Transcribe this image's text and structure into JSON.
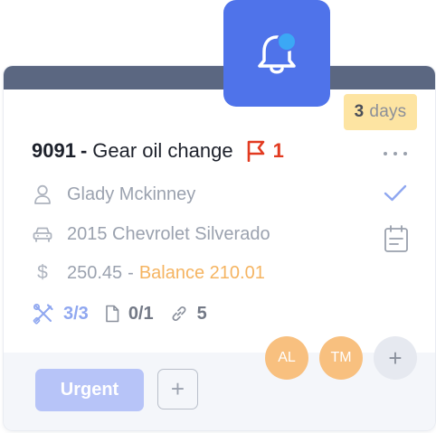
{
  "work_order": {
    "number": "9091",
    "dash": "-",
    "title": "Gear oil change",
    "flag_count": "1",
    "due": {
      "count": "3",
      "unit": "days"
    },
    "assignee": "Glady Mckinney",
    "vehicle": "2015 Chevrolet Silverado",
    "currency_symbol": "$",
    "amount": "250.45",
    "amount_sep": "-",
    "balance": "Balance 210.01",
    "stats": {
      "tasks": "3/3",
      "documents": "0/1",
      "links": "5"
    }
  },
  "avatars": [
    {
      "initials": "AL",
      "color": "#f8c07f"
    },
    {
      "initials": "TM",
      "color": "#f8c07f"
    }
  ],
  "avatar_add_label": "+",
  "tags": {
    "urgent_label": "Urgent",
    "add_label": "+"
  },
  "colors": {
    "accent": "#4f73ea",
    "topbar": "#5b6781",
    "flag": "#e23a20",
    "balance": "#f5b461",
    "days_badge": "#fde4a2",
    "urgent_tag": "#b7c4f8",
    "notification_dot": "#3ba8f5"
  },
  "icons": {
    "notification": "bell-icon",
    "flag": "flag-icon",
    "more": "more-horizontal-icon",
    "assignee": "user-icon",
    "vehicle": "car-icon",
    "check": "check-icon",
    "calendar": "calendar-icon",
    "tasks": "tools-icon",
    "documents": "document-icon",
    "links": "link-icon"
  }
}
